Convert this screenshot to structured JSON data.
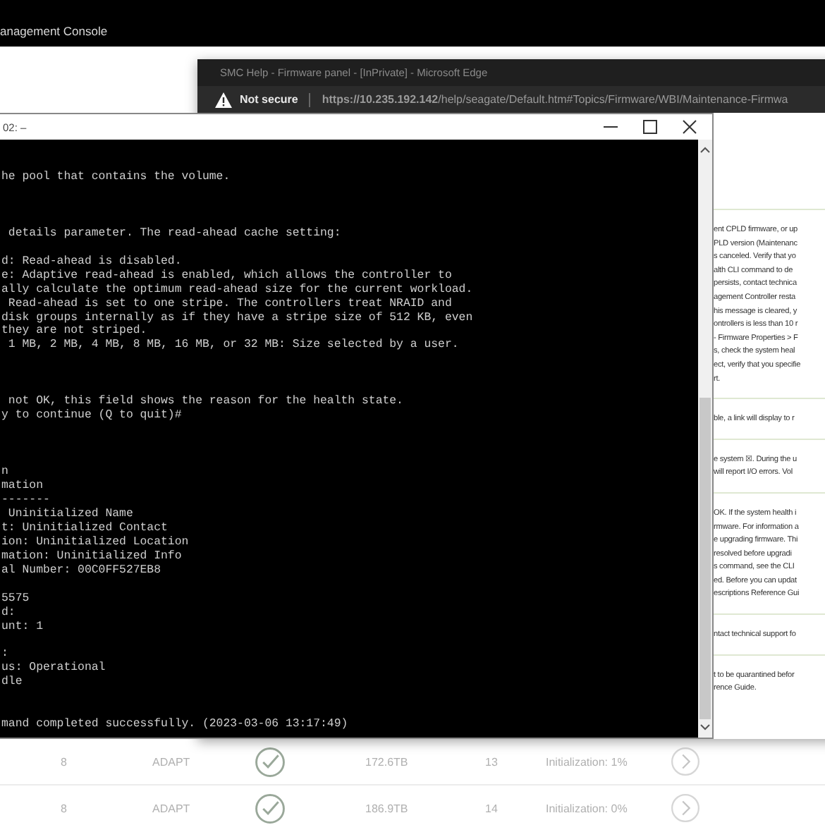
{
  "console_header": {
    "title": "anagement Console"
  },
  "table": {
    "rows": [
      {
        "column_1": "8",
        "column_2": "ADAPT",
        "column_4": "172.6TB",
        "column_5": "13",
        "column_6": "Initialization: 1%"
      },
      {
        "column_1": "8",
        "column_2": "ADAPT",
        "column_4": "186.9TB",
        "column_5": "14",
        "column_6": "Initialization: 0%"
      }
    ]
  },
  "browser_window": {
    "title": "SMC Help - Firmware panel - [InPrivate] - Microsoft Edge",
    "security": "Not secure",
    "url": "**https://10.235.192.142**/help/seagate/Default.htm#Topics/Firmware/WBI/Maintenance-Firmwa",
    "help_sections": [
      [
        "ent CPLD firmware, or up",
        "PLD version (Maintenanc",
        "s canceled. Verify that yo",
        "alth CLI command to de",
        "persists, contact technica",
        "agement Controller resta",
        "his message is cleared, y",
        "ontrollers is less than 10 r",
        "- Firmware Properties > F",
        "s, check the system heal",
        "ect, verify that you specifie",
        "rt."
      ],
      [
        "ble, a link will display to r"
      ],
      [
        "e system ☒. During the u",
        "will report I/O errors. Vol"
      ],
      [
        "OK. If the system health i",
        "rmware. For information a",
        "e upgrading firmware. Thi",
        "resolved before upgradi",
        "s command, see the CLI",
        "ed. Before you can updat",
        "escriptions Reference Gui"
      ],
      [
        "ntact technical support fo"
      ],
      [
        "t to be quarantined befor",
        "rence Guide."
      ]
    ]
  },
  "terminal_window": {
    "title": "02: –",
    "output": "he pool that contains the volume.\n\n\n\n details parameter. The read-ahead cache setting:\n\nd: Read-ahead is disabled.\ne: Adaptive read-ahead is enabled, which allows the controller to\nally calculate the optimum read-ahead size for the current workload.\n Read-ahead is set to one stripe. The controllers treat NRAID and\ndisk groups internally as if they have a stripe size of 512 KB, even\nthey are not striped.\n 1 MB, 2 MB, 4 MB, 8 MB, 16 MB, or 32 MB: Size selected by a user.\n\n\n\n not OK, this field shows the reason for the health state.\ny to continue (Q to quit)#\n\n\n\nn\nmation\n-------\n Uninitialized Name\nt: Uninitialized Contact\nion: Uninitialized Location\nmation: Uninitialized Info\nal Number: 00C0FF527EB8\n\n5575\nd:\nunt: 1\n\n:\nus: Operational\ndle\n\n\nmand completed successfully. (2023-03-06 13:17:49)"
  }
}
